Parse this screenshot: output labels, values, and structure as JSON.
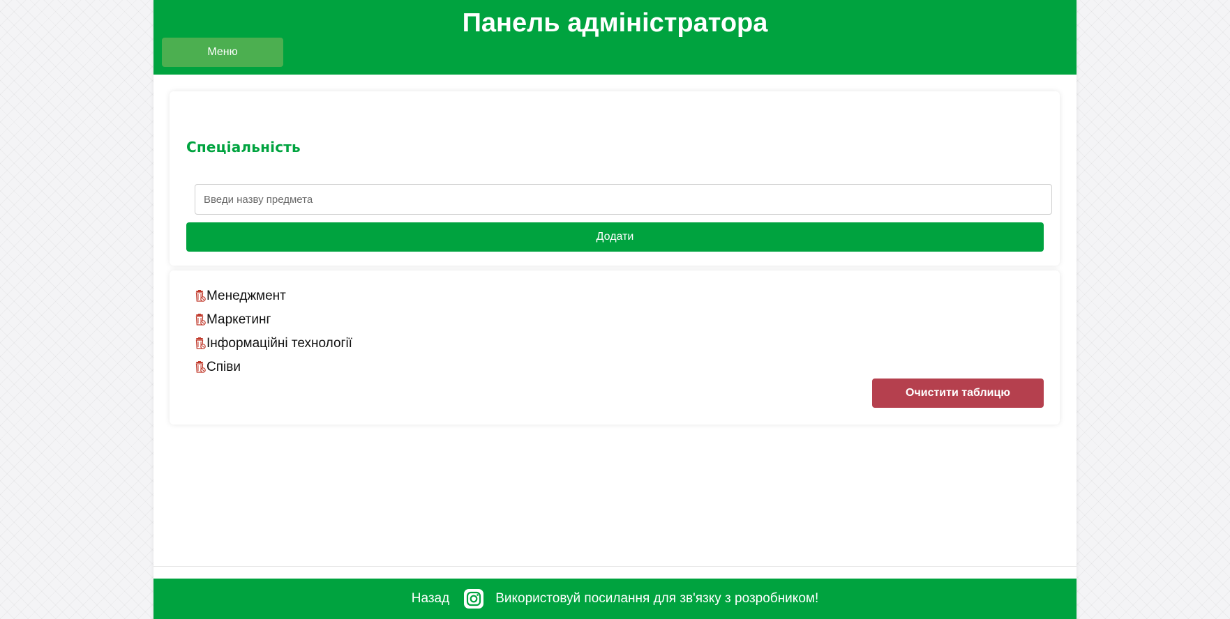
{
  "header": {
    "title": "Панель адміністратора",
    "menu_label": "Меню"
  },
  "form": {
    "section_title": "Спеціальність",
    "input_placeholder": "Введи назву предмета",
    "input_value": "",
    "add_label": "Додати"
  },
  "list": {
    "items": [
      {
        "label": "Менеджмент",
        "icon": "trash-icon"
      },
      {
        "label": "Маркетинг",
        "icon": "trash-icon"
      },
      {
        "label": "Інформаційні технології",
        "icon": "trash-icon"
      },
      {
        "label": "Співи",
        "icon": "trash-icon"
      }
    ],
    "clear_label": "Очистити таблицю"
  },
  "footer": {
    "back_label": "Назад",
    "contact_text": "Використовуй посилання для зв'язку з розробником!",
    "contact_icon": "instagram-icon"
  },
  "colors": {
    "accent": "#00a33f",
    "menu_button": "#4caf50",
    "danger": "#b5404e",
    "trash_icon": "#c0392b"
  }
}
